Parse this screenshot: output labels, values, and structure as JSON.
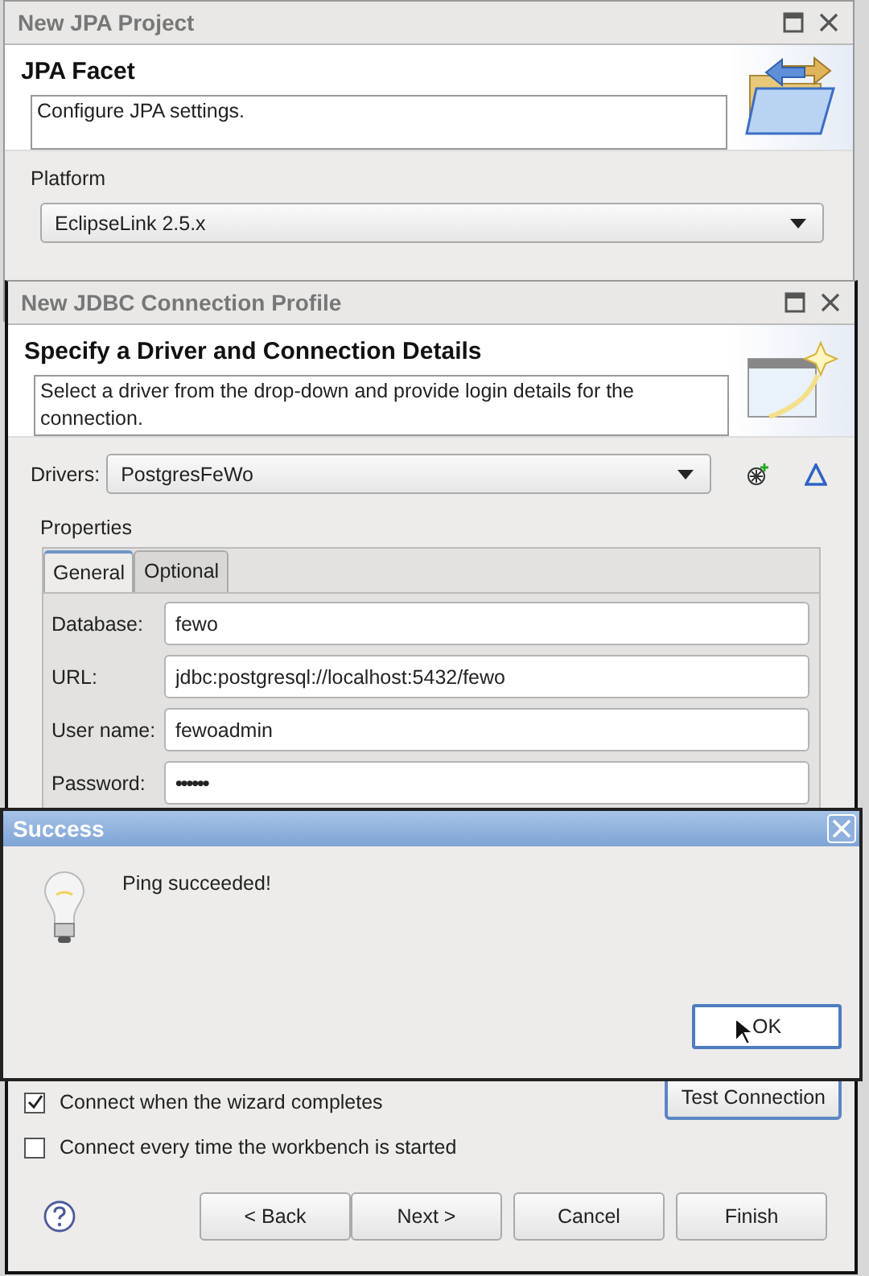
{
  "background_window": {
    "title": "New JPA Project",
    "page_title": "JPA Facet",
    "description": "Configure JPA settings.",
    "platform_label": "Platform",
    "platform_value": "EclipseLink 2.5.x"
  },
  "connection_window": {
    "title": "New JDBC Connection Profile",
    "page_title": "Specify a Driver and Connection Details",
    "description": "Select a driver from the drop-down and provide login details for the connection.",
    "drivers_label": "Drivers:",
    "driver": "PostgresFeWo",
    "properties_label": "Properties",
    "tabs": [
      {
        "label": "General",
        "selected": true
      },
      {
        "label": "Optional",
        "selected": false
      }
    ],
    "fields": [
      {
        "label": "Database:",
        "value": "fewo",
        "kind": "text"
      },
      {
        "label": "URL:",
        "value": "jdbc:postgresql://localhost:5432/fewo",
        "kind": "text"
      },
      {
        "label": "User name:",
        "value": "fewoadmin",
        "kind": "text"
      },
      {
        "label": "Password:",
        "value": "••••••",
        "kind": "password"
      }
    ],
    "options": [
      {
        "label": "Connect when the wizard completes",
        "checked": true
      },
      {
        "label": "Connect every time the workbench is started",
        "checked": false
      }
    ],
    "test_button": "Test Connection",
    "buttons": [
      "< Back",
      "Next >",
      "Cancel",
      "Finish"
    ]
  },
  "message_dialog": {
    "title": "Success",
    "message": "Ping succeeded!",
    "button": "OK"
  }
}
